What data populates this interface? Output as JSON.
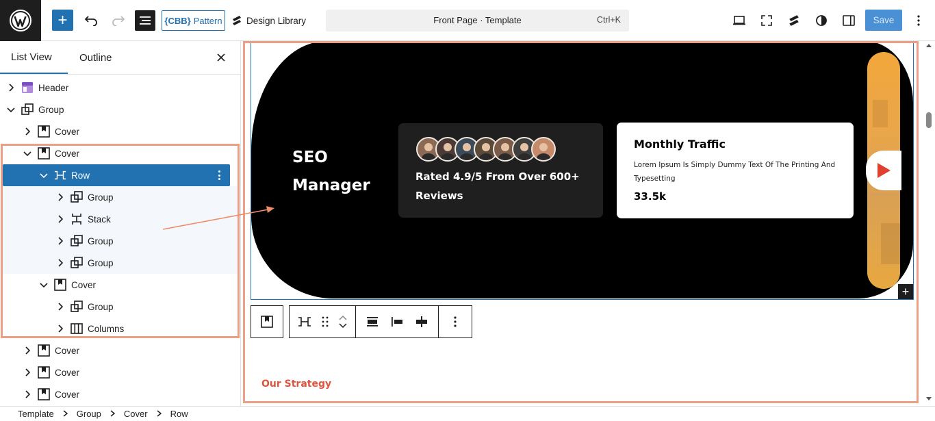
{
  "toolbar": {
    "pattern_label": "Pattern",
    "cbb_mark": "{CBB}",
    "design_library_label": "Design Library",
    "command_title": "Front Page · Template",
    "command_shortcut": "Ctrl+K",
    "save_label": "Save"
  },
  "sidebar": {
    "tabs": [
      {
        "label": "List View",
        "active": true
      },
      {
        "label": "Outline",
        "active": false
      }
    ],
    "tree": [
      {
        "label": "Header",
        "icon": "template-part-icon",
        "level": 0,
        "expanded": false
      },
      {
        "label": "Group",
        "icon": "group-icon",
        "level": 0,
        "expanded": true
      },
      {
        "label": "Cover",
        "icon": "cover-icon",
        "level": 1,
        "expanded": false
      },
      {
        "label": "Cover",
        "icon": "cover-icon",
        "level": 1,
        "expanded": true
      },
      {
        "label": "Row",
        "icon": "row-icon",
        "level": 2,
        "expanded": true,
        "selected": true
      },
      {
        "label": "Group",
        "icon": "group-icon",
        "level": 3,
        "expanded": false
      },
      {
        "label": "Stack",
        "icon": "stack-icon",
        "level": 3,
        "expanded": false
      },
      {
        "label": "Group",
        "icon": "group-icon",
        "level": 3,
        "expanded": false
      },
      {
        "label": "Group",
        "icon": "group-icon",
        "level": 3,
        "expanded": false
      },
      {
        "label": "Cover",
        "icon": "cover-icon",
        "level": 2,
        "expanded": true
      },
      {
        "label": "Group",
        "icon": "group-icon",
        "level": 3,
        "expanded": false
      },
      {
        "label": "Columns",
        "icon": "columns-icon",
        "level": 3,
        "expanded": false
      },
      {
        "label": "Cover",
        "icon": "cover-icon",
        "level": 1,
        "expanded": false
      },
      {
        "label": "Cover",
        "icon": "cover-icon",
        "level": 1,
        "expanded": false
      },
      {
        "label": "Cover",
        "icon": "cover-icon",
        "level": 1,
        "expanded": false
      }
    ]
  },
  "breadcrumb": [
    "Template",
    "Group",
    "Cover",
    "Row"
  ],
  "canvas": {
    "hero_title": "SEO Manager",
    "rated_text": "Rated 4.9/5 From Over 600+ Reviews",
    "traffic_title": "Monthly Traffic",
    "traffic_text": "Lorem Ipsum Is Simply Dummy Text Of The Printing And Typesetting",
    "traffic_value": "33.5k",
    "strategy_heading": "Our Strategy"
  },
  "colors": {
    "accent": "#2271b1",
    "highlight": "#ec9f85",
    "hero_bg": "#000000",
    "card_dark": "#1f1f1f",
    "play_red": "#e0402f",
    "strategy": "#e0533d"
  }
}
